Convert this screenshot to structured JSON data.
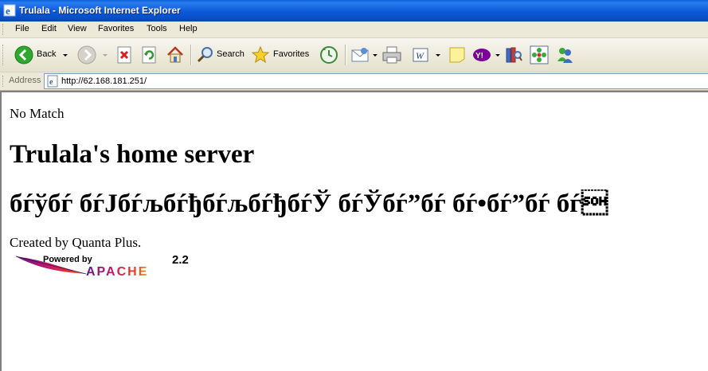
{
  "window": {
    "title": "Trulala - Microsoft Internet Explorer"
  },
  "menu": {
    "items": [
      "File",
      "Edit",
      "View",
      "Favorites",
      "Tools",
      "Help"
    ]
  },
  "toolbar": {
    "back_label": "Back",
    "search_label": "Search",
    "favorites_label": "Favorites"
  },
  "address": {
    "label": "Address",
    "url": "http://62.168.181.251/"
  },
  "page": {
    "no_match": "No Match",
    "heading": "Trulala's home server",
    "garbled_heading": "бѓўбѓ бѓЈбѓљбѓђбѓљбѓђбѓЎ бѓЎбѓ”бѓ бѓ•бѓ”бѓ бѓ\u0001",
    "created_by": "Created by Quanta Plus.",
    "badge": {
      "powered_by": "Powered by",
      "name": "APACHE",
      "version": "2.2"
    }
  },
  "colors": {
    "titlebar": "#0b58d6",
    "chrome": "#ece9d8",
    "apache_purple": "#6a1b9a",
    "apache_red": "#d62828",
    "apache_orange": "#f28c1b"
  }
}
